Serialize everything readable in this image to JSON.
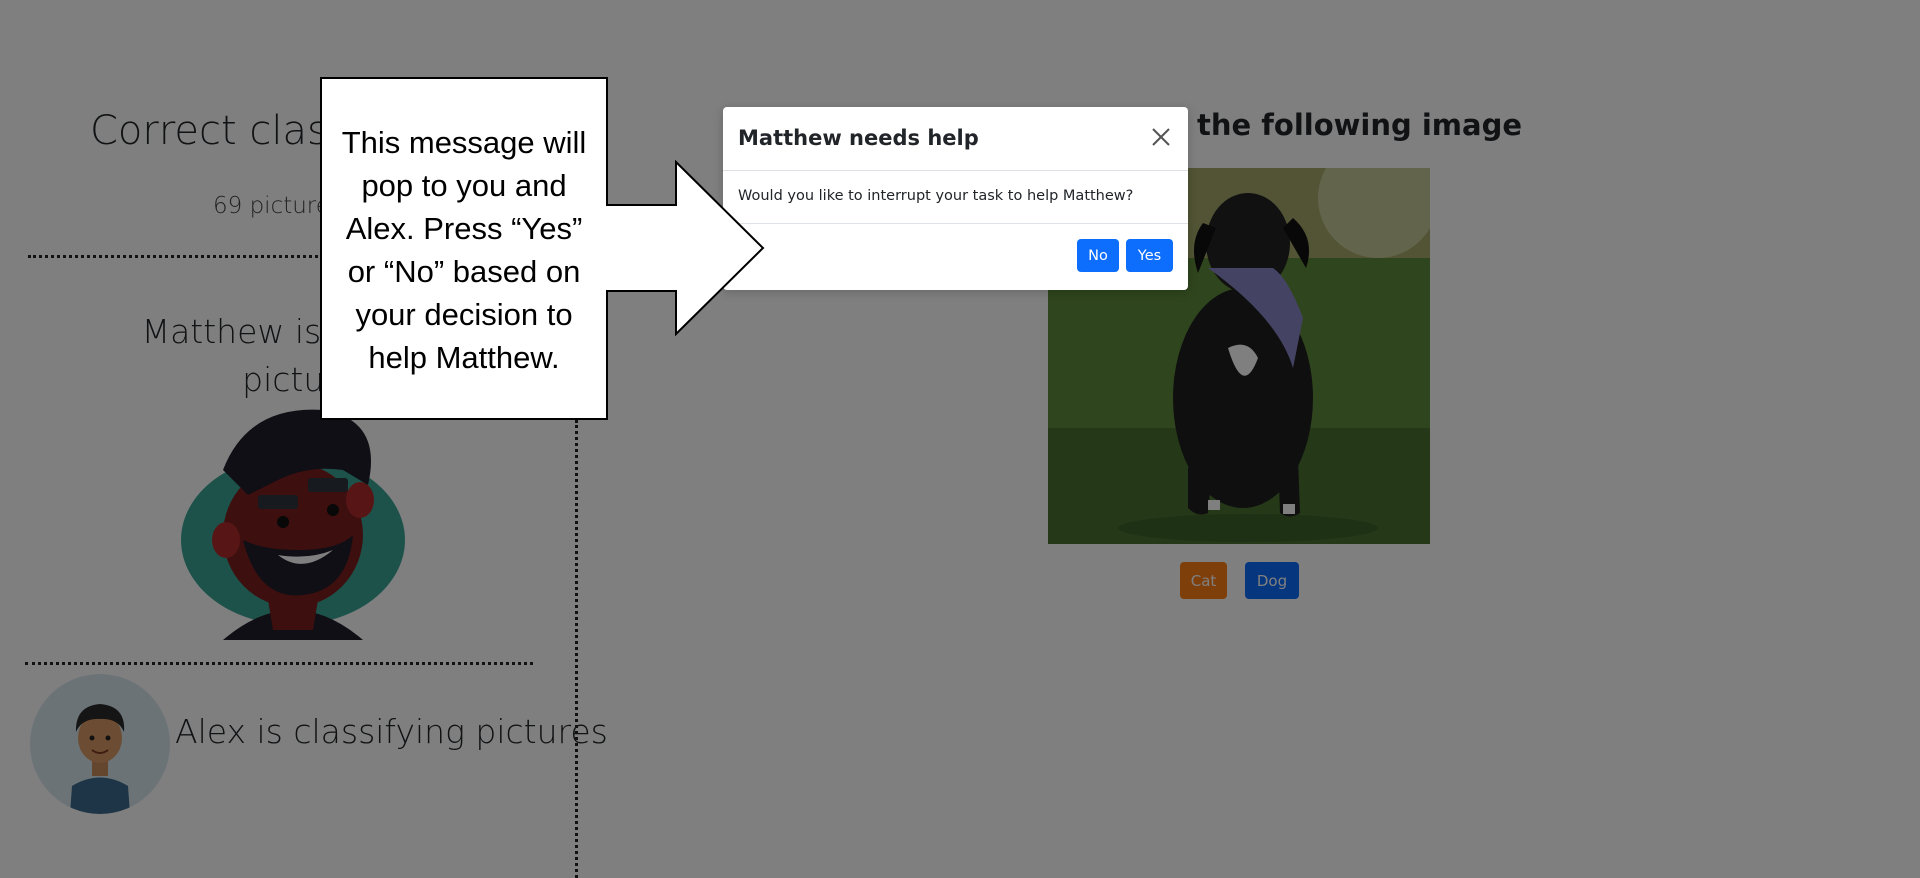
{
  "left_panel": {
    "title": "Correct classif",
    "count_text": "69 picture",
    "matthew_status": "Matthew is curren\npictur",
    "alex_status": "Alex is classifying pictures"
  },
  "right_panel": {
    "title": "y the following image",
    "image_alt": "Dog sitting on grass wearing a bandana",
    "cat_label": "Cat",
    "dog_label": "Dog"
  },
  "modal": {
    "title": "Matthew needs help",
    "body": "Would you like to interrupt your task to help Matthew?",
    "no_label": "No",
    "yes_label": "Yes"
  },
  "callout": {
    "text": "This message will pop to you and Alex. Press “Yes” or “No” based on your decision to help Matthew."
  },
  "colors": {
    "primary": "#0d6efd",
    "cat_button": "#fd7e14",
    "overlay": "rgba(0,0,0,0.5)"
  },
  "icons": {
    "close": "close-icon"
  }
}
